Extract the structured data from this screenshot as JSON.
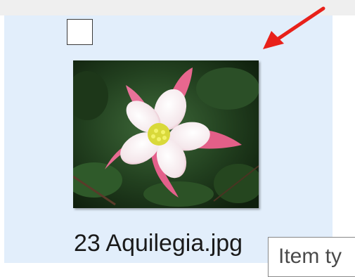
{
  "file_item": {
    "name": "23 Aquilegia.jpg",
    "selected_highlight_color": "#e2eefb",
    "checkbox_checked": false,
    "thumbnail_subject": "pink and white aquilegia flower"
  },
  "tooltip": {
    "text": "Item ty"
  },
  "annotation": {
    "arrow_color": "#e8211a"
  }
}
